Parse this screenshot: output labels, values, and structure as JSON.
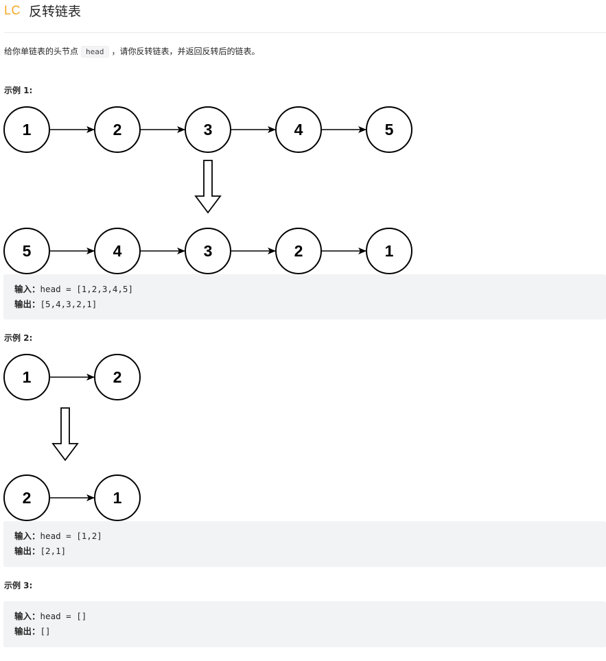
{
  "header": {
    "logo": "LC",
    "title": "反转链表"
  },
  "description": {
    "before": "给你单链表的头节点",
    "code": "head",
    "after": "，请你反转链表，并返回反转后的链表。"
  },
  "examples": [
    {
      "title": "示例 1:",
      "diagram": {
        "before": [
          "1",
          "2",
          "3",
          "4",
          "5"
        ],
        "after": [
          "5",
          "4",
          "3",
          "2",
          "1"
        ]
      },
      "input_label": "输入：",
      "input_value": "head = [1,2,3,4,5]",
      "output_label": "输出：",
      "output_value": "[5,4,3,2,1]"
    },
    {
      "title": "示例 2:",
      "diagram": {
        "before": [
          "1",
          "2"
        ],
        "after": [
          "2",
          "1"
        ]
      },
      "input_label": "输入：",
      "input_value": "head = [1,2]",
      "output_label": "输出：",
      "output_value": "[2,1]"
    },
    {
      "title": "示例 3:",
      "input_label": "输入：",
      "input_value": "head = []",
      "output_label": "输出：",
      "output_value": "[]"
    }
  ]
}
